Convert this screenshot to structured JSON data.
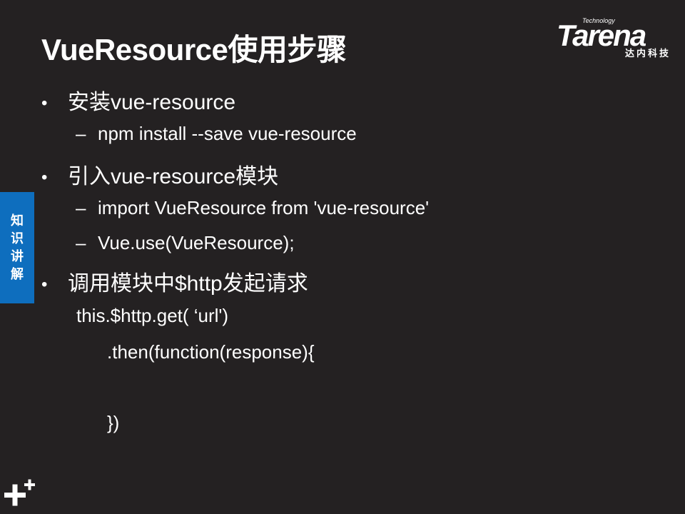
{
  "slide": {
    "title": "VueResource使用步骤",
    "side_tab_label": "知识讲解"
  },
  "logo": {
    "tech": "Technology",
    "brand": "Tarena",
    "subtitle": "达内科技"
  },
  "bullets": [
    {
      "text": "安装vue-resource",
      "sub": [
        "npm install --save vue-resource"
      ]
    },
    {
      "text": "引入vue-resource模块",
      "sub": [
        "import VueResource from 'vue-resource'",
        "Vue.use(VueResource);"
      ]
    },
    {
      "text": "调用模块中$http发起请求",
      "sub": []
    }
  ],
  "code_lines": [
    "this.$http.get(  ‘url')",
    ".then(function(response){",
    "})"
  ],
  "symbols": {
    "bullet": "•",
    "dash": "–"
  },
  "colors": {
    "background": "#242122",
    "side_tab": "#0e6ebe",
    "text": "#ffffff"
  }
}
